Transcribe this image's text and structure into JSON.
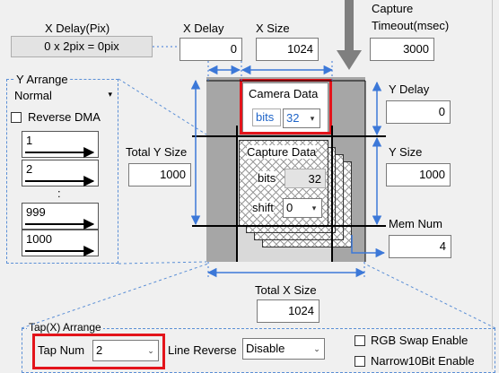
{
  "x_delay_pix": {
    "label": "X Delay(Pix)",
    "value": "0 x 2pix = 0pix"
  },
  "x_delay": {
    "label": "X Delay",
    "value": "0"
  },
  "x_size": {
    "label": "X Size",
    "value": "1024"
  },
  "capture_timeout": {
    "label_line1": "Capture",
    "label_line2": "Timeout(msec)",
    "value": "3000"
  },
  "y_arrange": {
    "title": "Y Arrange",
    "mode": "Normal",
    "reverse_dma_label": "Reverse DMA",
    "reverse_dma_checked": false,
    "lines": [
      "1",
      "2",
      "999",
      "1000"
    ],
    "ellipsis": ":"
  },
  "camera_data": {
    "title": "Camera Data",
    "bits_label": "bits",
    "bits_value": "32"
  },
  "capture_data": {
    "title": "Capture Data",
    "bits_label": "bits",
    "bits_value": "32",
    "shift_label": "shift",
    "shift_value": "0"
  },
  "y_delay": {
    "label": "Y Delay",
    "value": "0"
  },
  "total_y_size": {
    "label": "Total Y Size",
    "value": "1000"
  },
  "y_size": {
    "label": "Y Size",
    "value": "1000"
  },
  "mem_num": {
    "label": "Mem Num",
    "value": "4"
  },
  "total_x_size": {
    "label": "Total X Size",
    "value": "1024"
  },
  "tap_arrange": {
    "title": "Tap(X) Arrange",
    "tap_num_label": "Tap Num",
    "tap_num_value": "2",
    "line_reverse_label": "Line Reverse",
    "line_reverse_value": "Disable",
    "rgb_swap_label": "RGB Swap Enable",
    "narrow10bit_label": "Narrow10Bit Enable"
  },
  "colors": {
    "accent_red": "#e3141b",
    "arrow_blue": "#3c78d8",
    "dash_blue": "#5b8fd6"
  }
}
